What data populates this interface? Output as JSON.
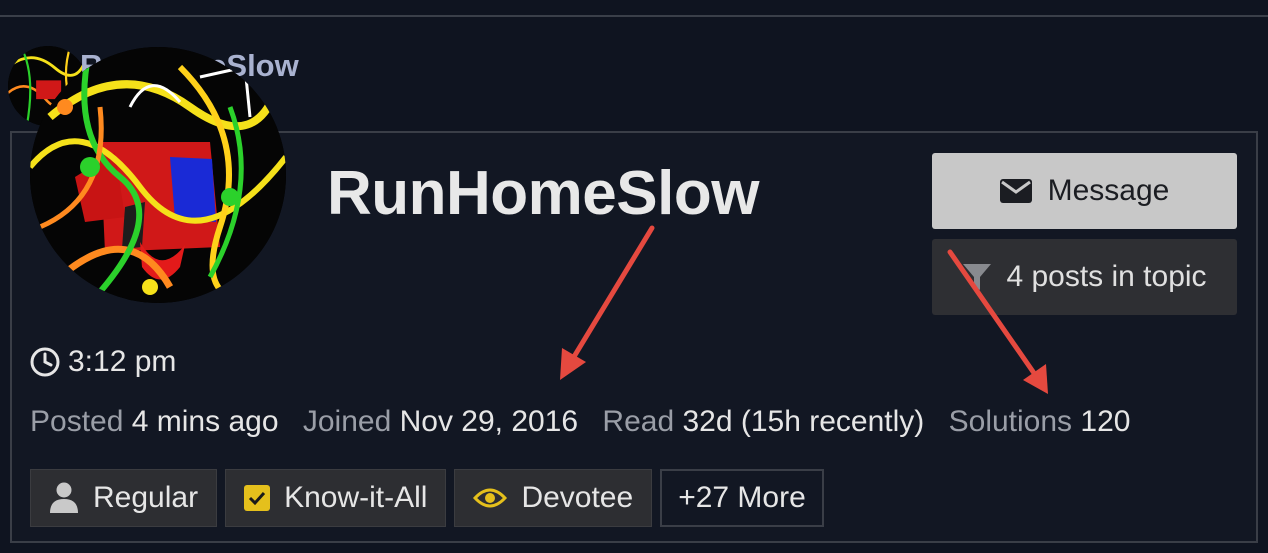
{
  "post": {
    "username": "RunHomeSlow"
  },
  "card": {
    "username": "RunHomeSlow",
    "message_button": "Message",
    "posts_in_topic_button": "4 posts in topic",
    "local_time": "3:12 pm",
    "meta": {
      "posted_label": "Posted",
      "posted_value": "4 mins ago",
      "joined_label": "Joined",
      "joined_value": "Nov 29, 2016",
      "read_label": "Read",
      "read_value": "32d (15h recently)",
      "solutions_label": "Solutions",
      "solutions_value": "120"
    },
    "badges": [
      {
        "label": "Regular",
        "icon": "user-icon"
      },
      {
        "label": "Know-it-All",
        "icon": "checkbox-icon"
      },
      {
        "label": "Devotee",
        "icon": "eye-icon"
      },
      {
        "label": "+27 More"
      }
    ]
  },
  "colors": {
    "accent_yellow": "#e5c01c",
    "arrow_red": "#e5493f",
    "message_bg": "#c8c8c8",
    "background": "#0f1420"
  }
}
